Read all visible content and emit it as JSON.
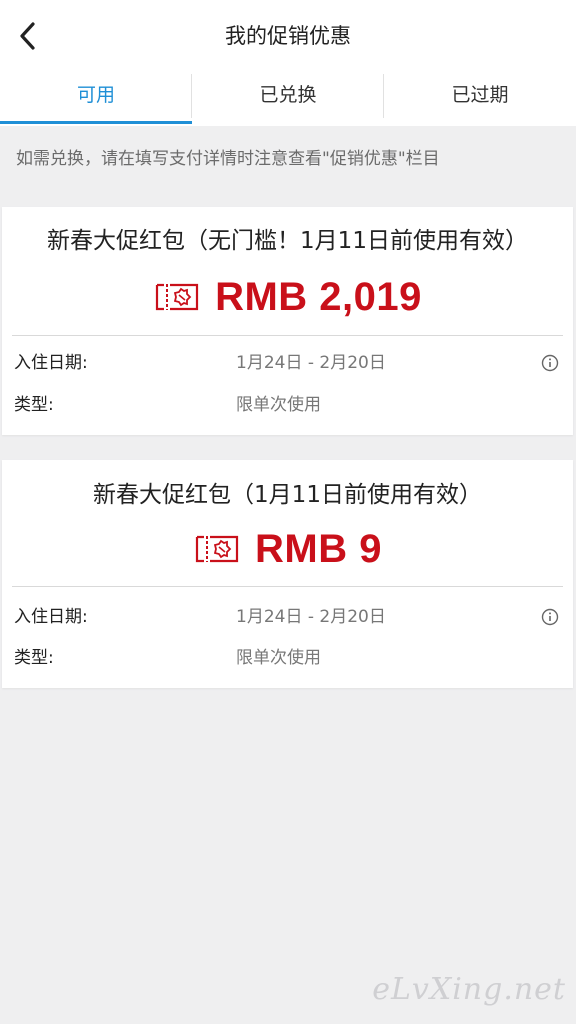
{
  "header": {
    "back_icon": "chevron-left-icon",
    "title": "我的促销优惠"
  },
  "tabs": [
    {
      "label": "可用",
      "active": true
    },
    {
      "label": "已兑换",
      "active": false
    },
    {
      "label": "已过期",
      "active": false
    }
  ],
  "notice": "如需兑换，请在填写支付详情时注意查看\"促销优惠\"栏目",
  "coupons": [
    {
      "title": "新春大促红包（无门槛！1月11日前使用有效）",
      "amount": "RMB 2,019",
      "icon": "coupon-icon",
      "stay_label": "入住日期:",
      "stay_value": "1月24日 - 2月20日",
      "type_label": "类型:",
      "type_value": "限单次使用"
    },
    {
      "title": "新春大促红包（1月11日前使用有效）",
      "amount": "RMB 9",
      "icon": "coupon-icon",
      "stay_label": "入住日期:",
      "stay_value": "1月24日 - 2月20日",
      "type_label": "类型:",
      "type_value": "限单次使用"
    }
  ],
  "watermark": "eLvXing.net",
  "colors": {
    "accent": "#1f8fd6",
    "amount": "#c9101a",
    "background": "#efeff0"
  }
}
